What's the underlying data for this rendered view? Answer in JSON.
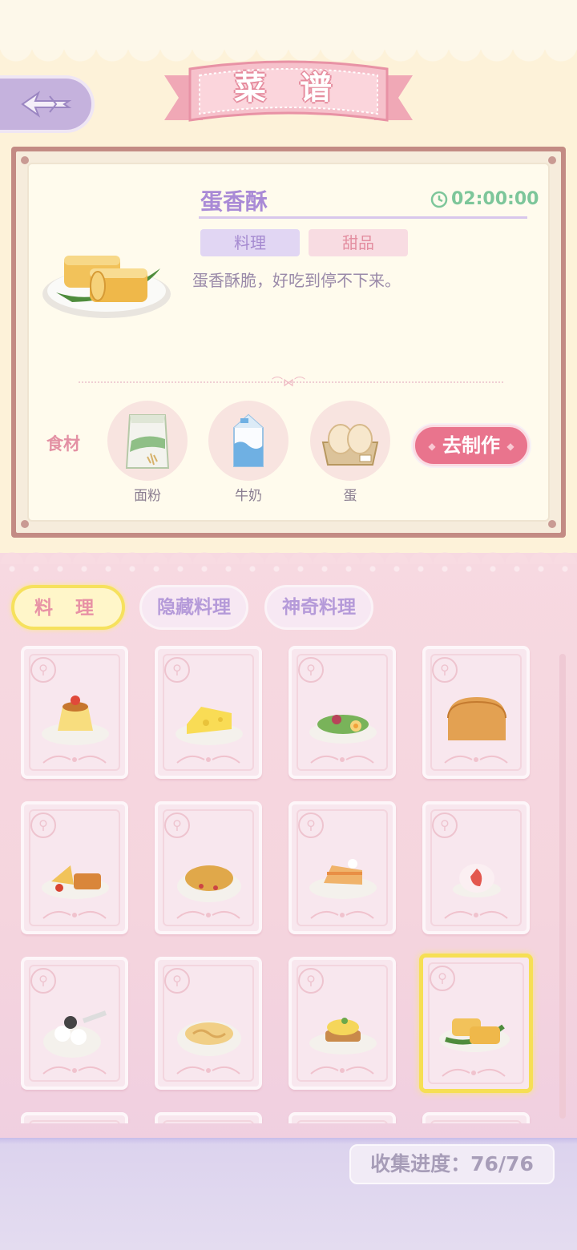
{
  "header": {
    "title": "菜 谱",
    "back_icon": "back-arrow-icon"
  },
  "recipe": {
    "name": "蛋香酥",
    "time": "02:00:00",
    "tags": [
      "料理",
      "甜品"
    ],
    "description": "蛋香酥脆，好吃到停不下来。",
    "ingredients_label": "食材",
    "ingredients": [
      {
        "name": "面粉",
        "icon": "flour-bag-icon"
      },
      {
        "name": "牛奶",
        "icon": "milk-carton-icon"
      },
      {
        "name": "蛋",
        "icon": "egg-box-icon"
      }
    ],
    "make_button": "去制作"
  },
  "tabs": [
    {
      "label": "料 理",
      "active": true
    },
    {
      "label": "隐藏料理",
      "active": false
    },
    {
      "label": "神奇料理",
      "active": false
    }
  ],
  "grid": {
    "items": [
      {
        "icon": "pudding-icon"
      },
      {
        "icon": "cheese-icon"
      },
      {
        "icon": "salad-icon"
      },
      {
        "icon": "bread-loaf-icon"
      },
      {
        "icon": "fries-toast-icon"
      },
      {
        "icon": "roast-chicken-soup-icon"
      },
      {
        "icon": "cake-slice-icon"
      },
      {
        "icon": "strawberry-daifuku-icon"
      },
      {
        "icon": "tangyuan-icon"
      },
      {
        "icon": "noodle-bowl-icon"
      },
      {
        "icon": "eggs-benedict-icon"
      },
      {
        "icon": "egg-roll-pastry-icon",
        "selected": true
      }
    ]
  },
  "progress": {
    "label": "收集进度：76/76",
    "collected": 76,
    "total": 76
  },
  "colors": {
    "accent_pink": "#e9748d",
    "accent_purple": "#a98ad6",
    "timer_green": "#7dc69a",
    "selected_yellow": "#f6df54"
  }
}
